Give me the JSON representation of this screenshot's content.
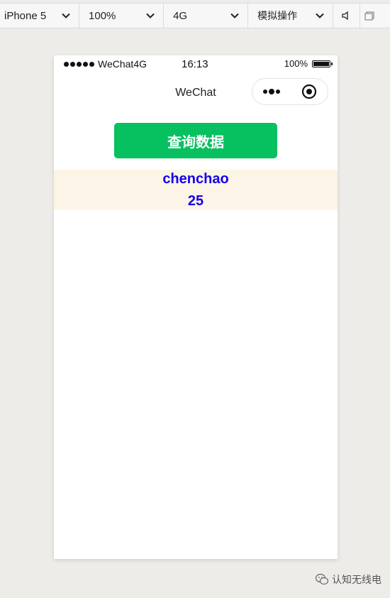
{
  "toolbar": {
    "device": "iPhone 5",
    "zoom": "100%",
    "network": "4G",
    "operation": "模拟操作"
  },
  "statusbar": {
    "carrier": "WeChat4G",
    "time": "16:13",
    "battery": "100%",
    "battery_level": 1.0
  },
  "navbar": {
    "title": "WeChat"
  },
  "page": {
    "query_button_label": "查询数据",
    "result_name": "chenchao",
    "result_age": "25"
  },
  "colors": {
    "primary_green": "#07c160",
    "result_bg": "#fcf4e6",
    "result_text": "#1400f0"
  },
  "watermark": {
    "text": "认知无线电"
  }
}
